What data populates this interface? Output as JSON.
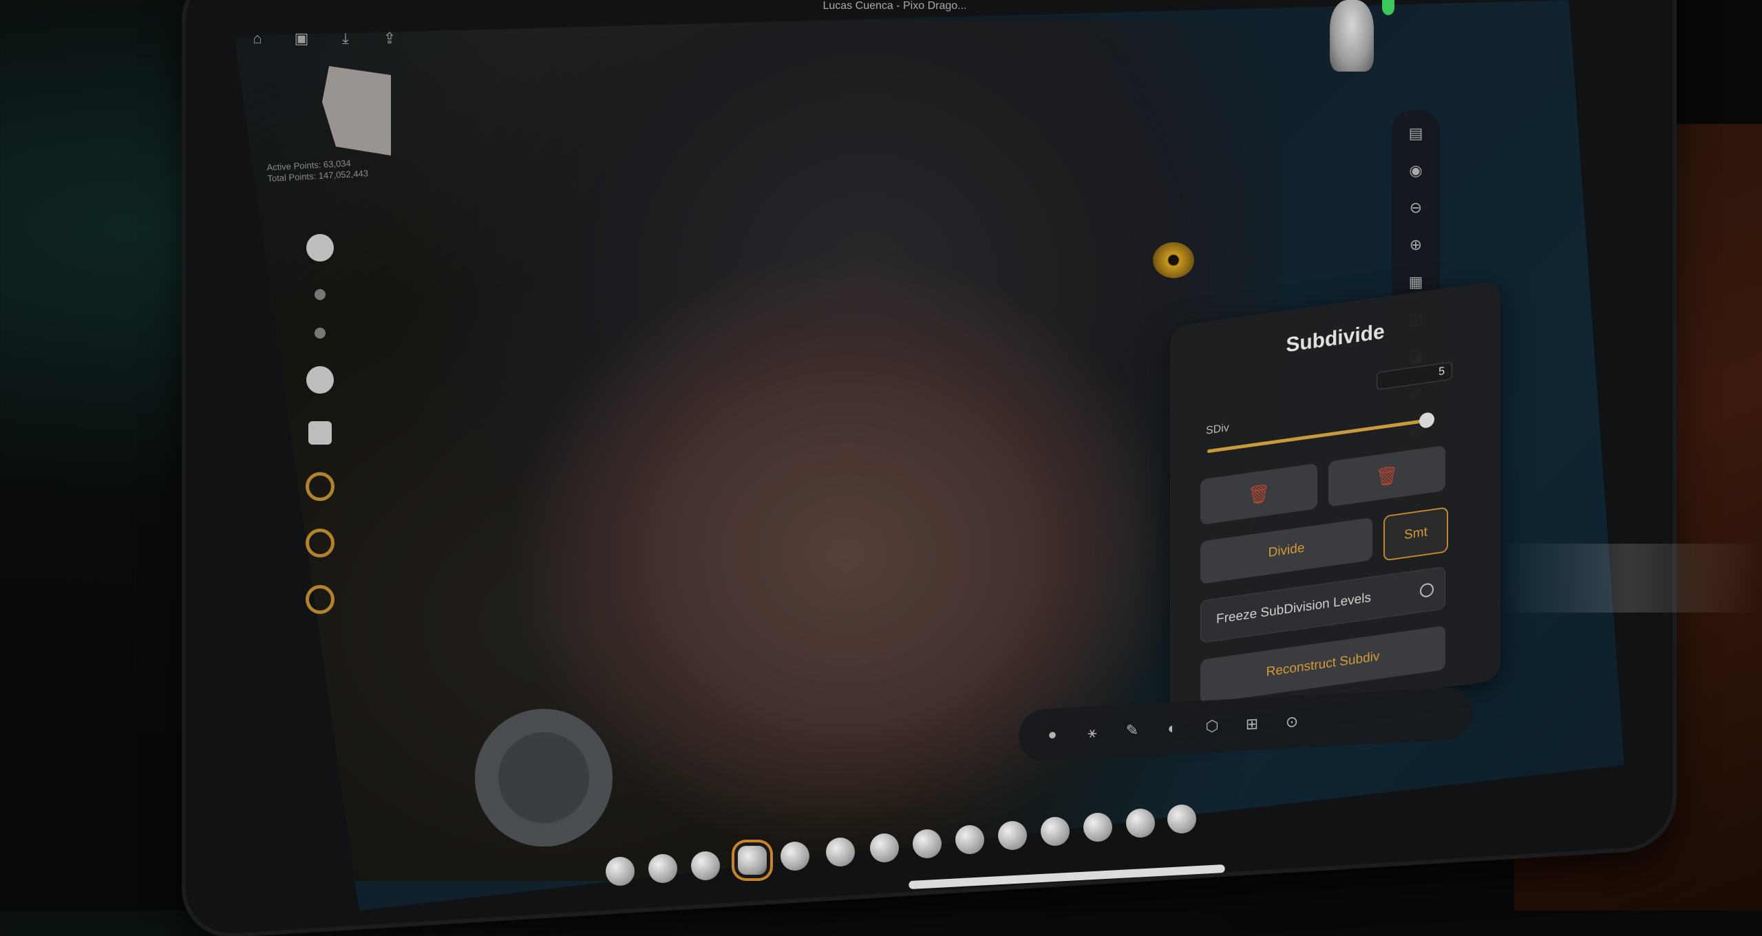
{
  "window": {
    "title": "Lucas Cuenca - Pixo Drago..."
  },
  "top_icons": [
    "home-icon",
    "save-icon",
    "import-icon",
    "share-icon"
  ],
  "stats": {
    "active_points": "Active Points: 63,034",
    "total_points": "Total Points: 147,052,443"
  },
  "subdivide_panel": {
    "title": "Subdivide",
    "sdiv_label": "SDiv",
    "sdiv_value": "5",
    "sdiv_level": 1.0,
    "divide_label": "Divide",
    "smt_label": "Smt",
    "freeze_label": "Freeze SubDivision Levels",
    "reconstruct_label": "Reconstruct Subdiv"
  },
  "colors": {
    "accent": "#c99a3c",
    "trash": "#b5452f",
    "panel_bg": "#1e1f21"
  }
}
